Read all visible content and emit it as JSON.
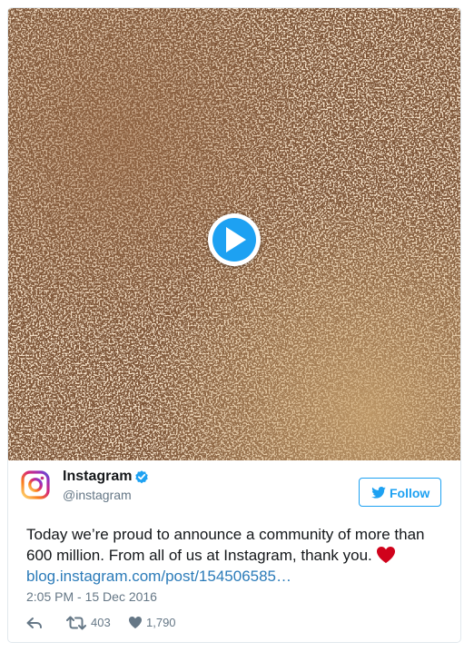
{
  "media": {
    "type": "video",
    "play_icon": "play-icon"
  },
  "author": {
    "name": "Instagram",
    "handle": "@instagram",
    "verified_icon": "verified-badge-icon",
    "avatar_icon": "instagram-logo-icon"
  },
  "follow": {
    "label": "Follow",
    "icon": "twitter-bird-icon"
  },
  "tweet": {
    "text_line": "Today we’re proud to announce a community of more than 600 million. From all of us at Instagram, thank you.",
    "emoji": "heart-emoji-icon",
    "link": "blog.instagram.com/post/154506585…",
    "timestamp": "2:05 PM - 15 Dec 2016"
  },
  "actions": {
    "reply_icon": "reply-icon",
    "retweet_icon": "retweet-icon",
    "retweet_count": "403",
    "like_icon": "heart-icon",
    "like_count": "1,790"
  },
  "colors": {
    "accent": "#1da1f2",
    "link": "#2b7bb9",
    "muted": "#657786",
    "text": "#14171a",
    "heart": "#e0245e",
    "border": "#e1e8ed"
  }
}
